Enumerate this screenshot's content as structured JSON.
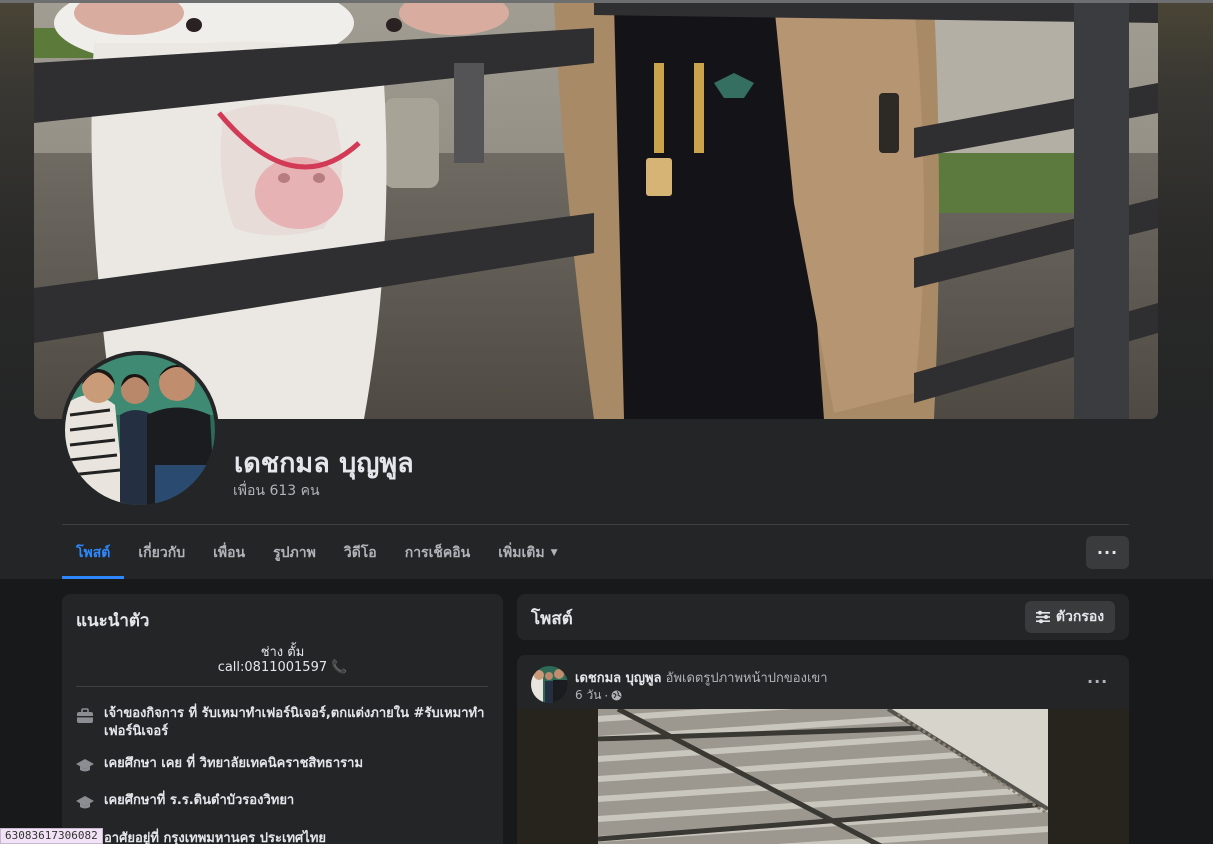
{
  "profile": {
    "name": "เดชกมล บุญพูล",
    "friends_text": "เพื่อน 613 คน"
  },
  "tabs": [
    {
      "label": "โพสต์",
      "active": true
    },
    {
      "label": "เกี่ยวกับ",
      "active": false
    },
    {
      "label": "เพื่อน",
      "active": false
    },
    {
      "label": "รูปภาพ",
      "active": false
    },
    {
      "label": "วิดีโอ",
      "active": false
    },
    {
      "label": "การเช็คอิน",
      "active": false
    },
    {
      "label": "เพิ่มเติม",
      "active": false
    }
  ],
  "more_button": "···",
  "intro": {
    "title": "แนะนำตัว",
    "bio_line1": "ช่าง ตั้ม",
    "bio_line2": "call:0811001597",
    "items": [
      {
        "icon": "briefcase-icon",
        "text": "เจ้าของกิจการ ที่ รับเหมาทำเฟอร์นิเจอร์,ตกแต่งภายใน #รับเหมาทำเฟอร์นิเจอร์"
      },
      {
        "icon": "graduation-cap-icon",
        "text": "เคยศึกษา เคย ที่ วิทยาลัยเทคนิคราชสิทธาราม"
      },
      {
        "icon": "graduation-cap-icon",
        "text": "เคยศึกษาที่ ร.ร.ดินดำบัวรองวิทยา"
      },
      {
        "icon": "home-icon",
        "text": "อาศัยอยู่ที่ กรุงเทพมหานคร ประเทศไทย"
      }
    ]
  },
  "posts": {
    "title": "โพสต์",
    "filter_label": "ตัวกรอง"
  },
  "post": {
    "author": "เดชกมล บุญพูล",
    "action": "อัพเดตรูปภาพหน้าปกของเขา",
    "time": "6 วัน",
    "separator": "·",
    "privacy_icon": "globe-icon",
    "more": "···"
  },
  "status_url": "63083617306082",
  "colors": {
    "accent": "#2d88ff",
    "background": "#18191a",
    "card": "#242526",
    "button": "#3a3b3c"
  }
}
